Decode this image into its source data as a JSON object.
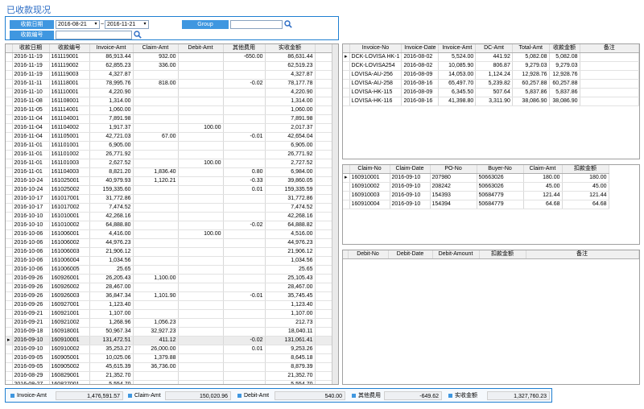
{
  "window": {
    "title": "已收款现况"
  },
  "filter": {
    "date_label": "收款日期",
    "date_from": "2016-08-21",
    "date_to": "2016-11-21",
    "range_sep": "~",
    "group_label": "Group",
    "group_value": "",
    "no_label": "收款编号",
    "no_value": ""
  },
  "main_table": {
    "headers": [
      "收款日期",
      "收款编号",
      "Invoice-Amt",
      "Claim-Amt",
      "Debit-Amt",
      "其他费用",
      "实收金额"
    ],
    "rows": [
      [
        "2016-11-19",
        "161119001",
        "86,913.44",
        "932.00",
        "",
        "-650.00",
        "86,631.44"
      ],
      [
        "2016-11-19",
        "161119002",
        "62,855.23",
        "336.00",
        "",
        "",
        "62,519.23"
      ],
      [
        "2016-11-19",
        "161119003",
        "4,327.87",
        "",
        "",
        "",
        "4,327.87"
      ],
      [
        "2016-11-11",
        "161118001",
        "78,995.76",
        "818.00",
        "",
        "-0.02",
        "78,177.78"
      ],
      [
        "2016-11-10",
        "161110001",
        "4,220.90",
        "",
        "",
        "",
        "4,220.90"
      ],
      [
        "2016-11-08",
        "161108001",
        "1,314.00",
        "",
        "",
        "",
        "1,314.00"
      ],
      [
        "2016-11-05",
        "161114001",
        "1,060.00",
        "",
        "",
        "",
        "1,060.00"
      ],
      [
        "2016-11-04",
        "161104001",
        "7,891.98",
        "",
        "",
        "",
        "7,891.98"
      ],
      [
        "2016-11-04",
        "161104002",
        "1,917.37",
        "",
        "100.00",
        "",
        "2,017.37"
      ],
      [
        "2016-11-04",
        "161105001",
        "42,721.03",
        "67.00",
        "",
        "-0.01",
        "42,654.04"
      ],
      [
        "2016-11-01",
        "161101001",
        "6,905.00",
        "",
        "",
        "",
        "6,905.00"
      ],
      [
        "2016-11-01",
        "161101002",
        "26,771.92",
        "",
        "",
        "",
        "26,771.92"
      ],
      [
        "2016-11-01",
        "161101003",
        "2,627.52",
        "",
        "100.00",
        "",
        "2,727.52"
      ],
      [
        "2016-11-01",
        "161104003",
        "8,821.20",
        "1,836.40",
        "",
        "0.80",
        "6,984.00"
      ],
      [
        "2016-10-24",
        "161025001",
        "40,979.93",
        "1,120.21",
        "",
        "-0.33",
        "39,860.05"
      ],
      [
        "2016-10-24",
        "161025002",
        "159,335.60",
        "",
        "",
        "0.01",
        "159,335.59"
      ],
      [
        "2016-10-17",
        "161017001",
        "31,772.86",
        "",
        "",
        "",
        "31,772.86"
      ],
      [
        "2016-10-17",
        "161017002",
        "7,474.52",
        "",
        "",
        "",
        "7,474.52"
      ],
      [
        "2016-10-10",
        "161010001",
        "42,268.16",
        "",
        "",
        "",
        "42,268.16"
      ],
      [
        "2016-10-10",
        "161010002",
        "64,888.80",
        "",
        "",
        "-0.02",
        "64,888.82"
      ],
      [
        "2016-10-06",
        "161006001",
        "4,416.00",
        "",
        "100.00",
        "",
        "4,516.00"
      ],
      [
        "2016-10-06",
        "161006002",
        "44,976.23",
        "",
        "",
        "",
        "44,976.23"
      ],
      [
        "2016-10-06",
        "161006003",
        "21,906.12",
        "",
        "",
        "",
        "21,906.12"
      ],
      [
        "2016-10-06",
        "161006004",
        "1,034.56",
        "",
        "",
        "",
        "1,034.56"
      ],
      [
        "2016-10-06",
        "161006005",
        "25.65",
        "",
        "",
        "",
        "25.65"
      ],
      [
        "2016-09-26",
        "160926001",
        "26,205.43",
        "1,100.00",
        "",
        "",
        "25,105.43"
      ],
      [
        "2016-09-26",
        "160926002",
        "28,467.00",
        "",
        "",
        "",
        "28,467.00"
      ],
      [
        "2016-09-26",
        "160926003",
        "36,847.34",
        "1,101.90",
        "",
        "-0.01",
        "35,745.45"
      ],
      [
        "2016-09-26",
        "160927001",
        "1,123.40",
        "",
        "",
        "",
        "1,123.40"
      ],
      [
        "2016-09-21",
        "160921001",
        "1,107.00",
        "",
        "",
        "",
        "1,107.00"
      ],
      [
        "2016-09-21",
        "160921002",
        "1,268.96",
        "1,056.23",
        "",
        "",
        "212.73"
      ],
      [
        "2016-09-18",
        "160918001",
        "50,967.34",
        "32,927.23",
        "",
        "",
        "18,040.11"
      ],
      [
        "2016-09-10",
        "160910001",
        "131,472.51",
        "411.12",
        "",
        "-0.02",
        "131,061.41"
      ],
      [
        "2016-09-10",
        "160910002",
        "35,253.27",
        "26,000.00",
        "",
        "0.01",
        "9,253.26"
      ],
      [
        "2016-09-05",
        "160905001",
        "10,025.06",
        "1,379.88",
        "",
        "",
        "8,645.18"
      ],
      [
        "2016-09-05",
        "160905002",
        "45,615.39",
        "36,736.00",
        "",
        "",
        "8,879.39"
      ],
      [
        "2016-08-29",
        "160829001",
        "21,352.70",
        "",
        "",
        "",
        "21,352.70"
      ],
      [
        "2016-08-27",
        "160827001",
        "5,554.70",
        "",
        "",
        "",
        "5,554.70"
      ]
    ],
    "selected_row": 32
  },
  "invoice_table": {
    "headers": [
      "Invoice-No",
      "Invoice-Date",
      "Invoice-Amt",
      "DC-Amt",
      "Total-Amt",
      "收款金额",
      "备注"
    ],
    "rows": [
      [
        "DCK-LOVISA HK-1",
        "2016-08-02",
        "5,524.00",
        "441.92",
        "5,082.08",
        "5,082.08",
        ""
      ],
      [
        "DCK-LOVISA254",
        "2016-08-02",
        "10,085.90",
        "806.87",
        "9,279.03",
        "9,279.03",
        ""
      ],
      [
        "LOVISA-AU-256",
        "2016-08-09",
        "14,053.00",
        "1,124.24",
        "12,928.76",
        "12,928.76",
        ""
      ],
      [
        "LOVISA-AU-258",
        "2016-08-16",
        "65,497.70",
        "5,239.82",
        "60,257.88",
        "60,257.88",
        ""
      ],
      [
        "LOVISA-HK-115",
        "2016-08-09",
        "6,345.50",
        "507.64",
        "5,837.86",
        "5,837.86",
        ""
      ],
      [
        "LOVISA-HK-116",
        "2016-08-16",
        "41,398.80",
        "3,311.90",
        "38,086.90",
        "38,086.90",
        ""
      ]
    ]
  },
  "claim_table": {
    "headers": [
      "Claim-No",
      "Claim-Date",
      "PO-No",
      "Buyer-No",
      "Claim-Amt",
      "扣款金额"
    ],
    "rows": [
      [
        "160910001",
        "2016-09-10",
        "207980",
        "50663026",
        "180.00",
        "180.00"
      ],
      [
        "160910002",
        "2016-09-10",
        "208242",
        "50663026",
        "45.00",
        "45.00"
      ],
      [
        "160910003",
        "2016-09-10",
        "154393",
        "50684779",
        "121.44",
        "121.44"
      ],
      [
        "160910004",
        "2016-09-10",
        "154394",
        "50684779",
        "64.68",
        "64.68"
      ]
    ]
  },
  "debit_table": {
    "headers": [
      "Debit-No",
      "Debit-Date",
      "Debit-Amount",
      "扣款金额",
      "备注"
    ],
    "rows": []
  },
  "footer": {
    "invoice_label": "Invoice-Amt",
    "invoice_value": "1,476,591.57",
    "claim_label": "Claim-Amt",
    "claim_value": "150,020.96",
    "debit_label": "Debit-Amt",
    "debit_value": "540.00",
    "other_label": "其他费用",
    "other_value": "-649.62",
    "actual_label": "实收金额",
    "actual_value": "1,327,760.23"
  },
  "colors": {
    "accent": "#3f97e0",
    "border": "#1f7fd1",
    "title": "#2b6cc4"
  },
  "icons": {
    "search": "search-icon",
    "row_pointer": "row-pointer-icon",
    "dropdown": "chevron-down-icon"
  }
}
